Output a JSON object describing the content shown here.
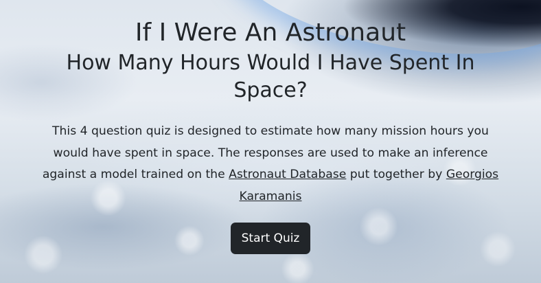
{
  "header": {
    "title": "If I Were An Astronaut",
    "subtitle": "How Many Hours Would I Have Spent In Space?"
  },
  "intro": {
    "text_before_link1": "This 4 question quiz is designed to estimate how many mission hours you would have spent in space. The responses are used to make an inference against a model trained on the ",
    "link1_text": "Astronaut Database",
    "text_between_links": " put together by ",
    "link2_text": "Georgios Karamanis"
  },
  "actions": {
    "start_label": "Start Quiz"
  },
  "colors": {
    "text": "#212529",
    "button_bg": "#212529",
    "button_text": "#ffffff"
  }
}
